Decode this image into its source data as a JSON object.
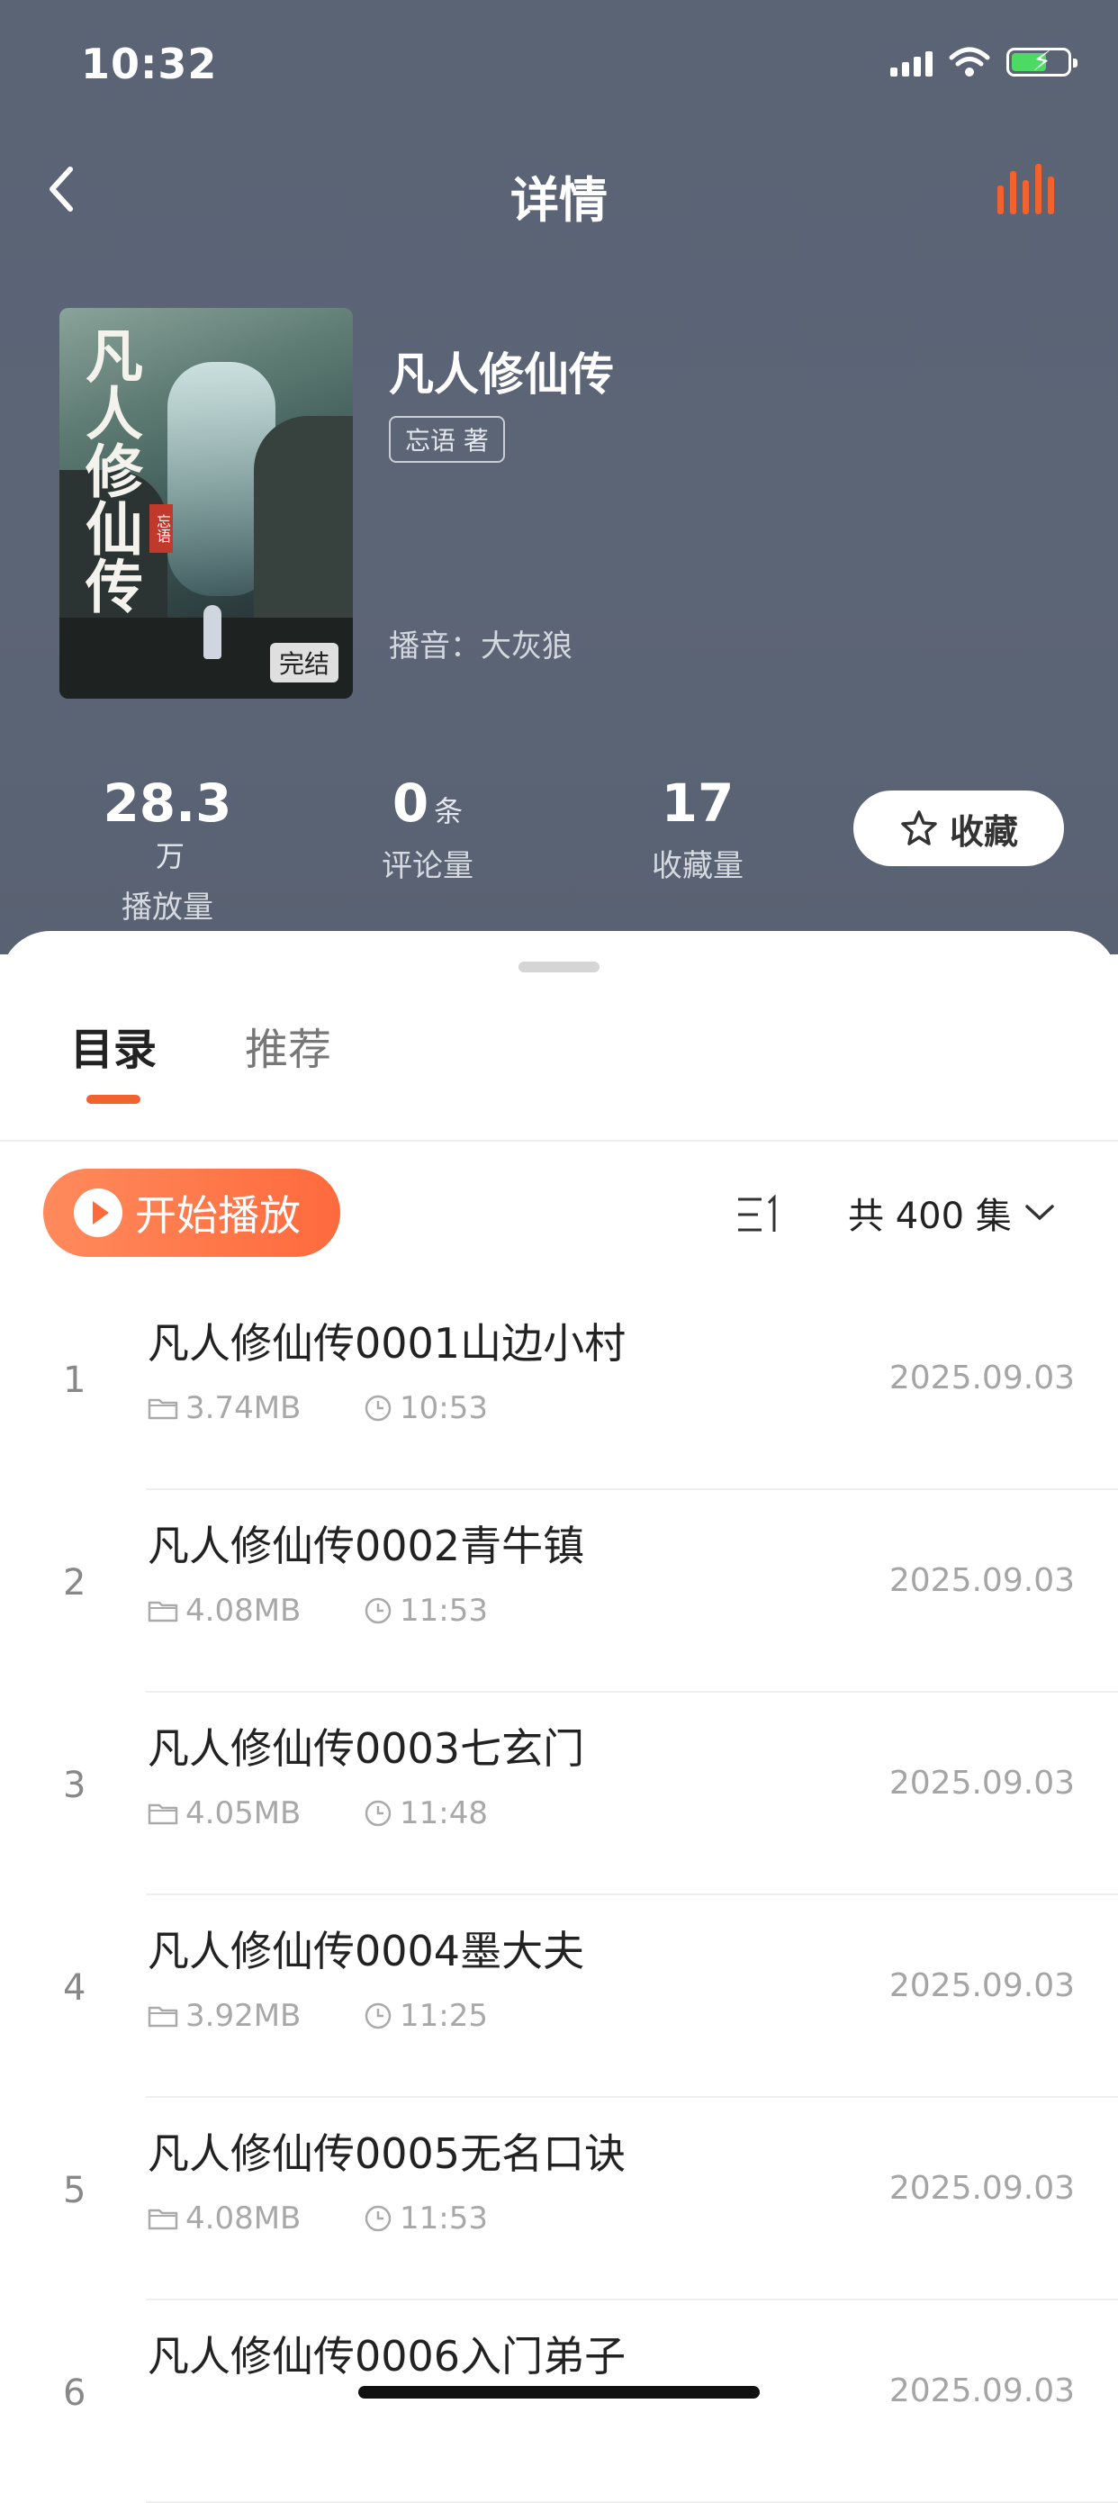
{
  "status": {
    "time": "10:32"
  },
  "nav": {
    "title": "详情",
    "back_icon": "chevron-left-icon",
    "player_icon": "equalizer-icon"
  },
  "book": {
    "title": "凡人修仙传",
    "author": "忘语 著",
    "narrator": "播音：大灰狼",
    "status": "完结",
    "cover_calligraphy": "凡人修仙传",
    "cover_seal": "忘语"
  },
  "stats": {
    "plays": {
      "value": "28.3",
      "unit": "万",
      "label": "播放量"
    },
    "comments": {
      "value": "0",
      "unit": "条",
      "label": "评论量"
    },
    "favorites": {
      "value": "17",
      "label": "收藏量"
    }
  },
  "favorite_button": "收藏",
  "tabs": [
    {
      "label": "目录",
      "active": true
    },
    {
      "label": "推荐",
      "active": false
    }
  ],
  "toolbar": {
    "play_label": "开始播放",
    "total": "共 400 集"
  },
  "episodes": [
    {
      "index": "1",
      "title": "凡人修仙传0001山边小村",
      "size": "3.74MB",
      "duration": "10:53",
      "date": "2025.09.03"
    },
    {
      "index": "2",
      "title": "凡人修仙传0002青牛镇",
      "size": "4.08MB",
      "duration": "11:53",
      "date": "2025.09.03"
    },
    {
      "index": "3",
      "title": "凡人修仙传0003七玄门",
      "size": "4.05MB",
      "duration": "11:48",
      "date": "2025.09.03"
    },
    {
      "index": "4",
      "title": "凡人修仙传0004墨大夫",
      "size": "3.92MB",
      "duration": "11:25",
      "date": "2025.09.03"
    },
    {
      "index": "5",
      "title": "凡人修仙传0005无名口诀",
      "size": "4.08MB",
      "duration": "11:53",
      "date": "2025.09.03"
    },
    {
      "index": "6",
      "title": "凡人修仙传0006入门弟子",
      "size": "",
      "duration": "",
      "date": "2025.09.03"
    }
  ],
  "colors": {
    "accent": "#f2622e",
    "header_bg": "#5a6475"
  }
}
